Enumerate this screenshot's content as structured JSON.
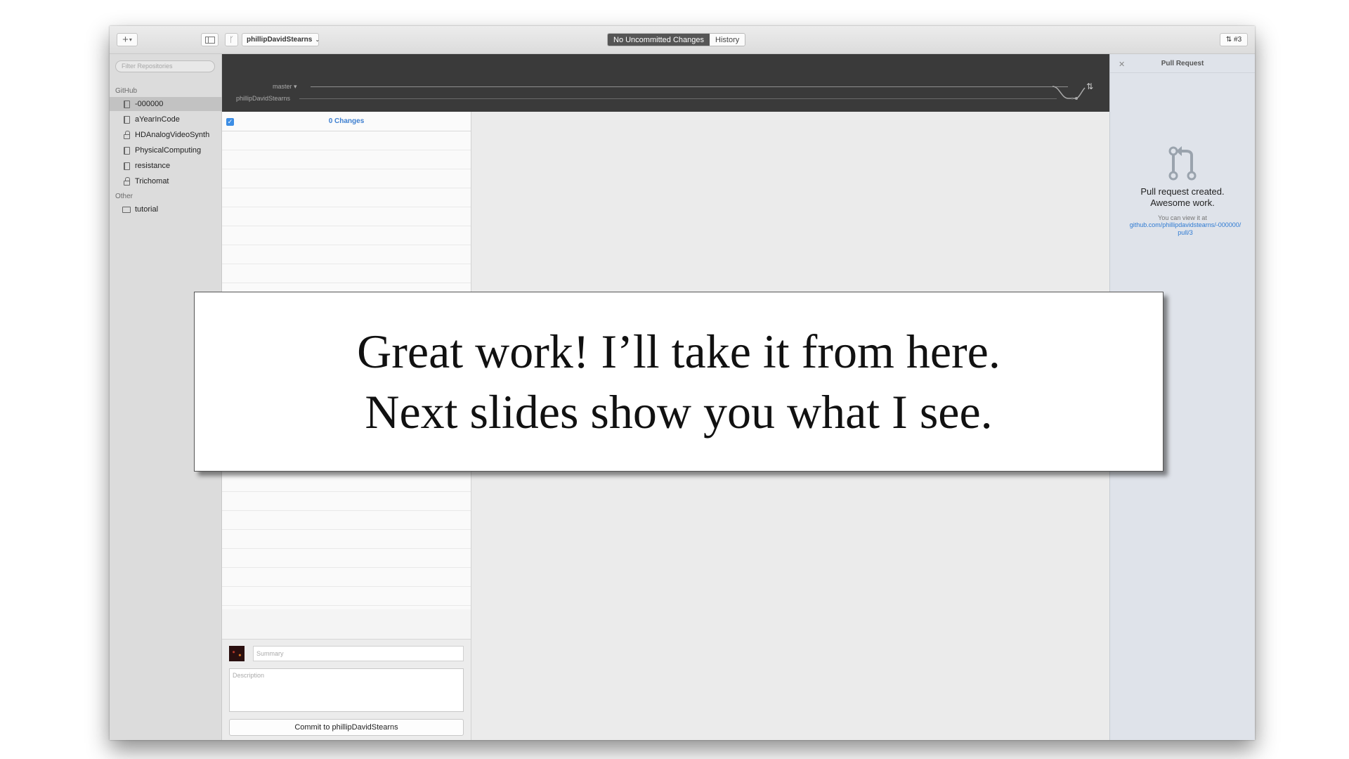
{
  "titlebar": {
    "add_icon": "plus-icon",
    "repo_selector": "phillipDavidStearns",
    "tabs": [
      {
        "label": "No Uncommitted Changes",
        "active": true
      },
      {
        "label": "History",
        "active": false
      }
    ],
    "pull_request_badge": "#3"
  },
  "sidebar": {
    "filter_placeholder": "Filter Repositories",
    "groups": [
      {
        "title": "GitHub",
        "items": [
          {
            "label": "-000000",
            "icon": "repo-icon",
            "selected": true
          },
          {
            "label": "aYearInCode",
            "icon": "repo-icon"
          },
          {
            "label": "HDAnalogVideoSynth",
            "icon": "lock-icon"
          },
          {
            "label": "PhysicalComputing",
            "icon": "repo-icon"
          },
          {
            "label": "resistance",
            "icon": "repo-icon"
          },
          {
            "label": "Trichomat",
            "icon": "lock-icon"
          }
        ]
      },
      {
        "title": "Other",
        "items": [
          {
            "label": "tutorial",
            "icon": "monitor-icon"
          }
        ]
      }
    ]
  },
  "graph": {
    "branch_label": "master ▾",
    "remote_label": "phillipDavidStearns"
  },
  "changes": {
    "title": "0 Changes",
    "summary_placeholder": "Summary",
    "description_placeholder": "Description",
    "commit_label": "Commit to phillipDavidStearns"
  },
  "pull_request_panel": {
    "title": "Pull Request",
    "message_line1": "Pull request created.",
    "message_line2": "Awesome work.",
    "view_text": "You can view it at",
    "link_line1": "github.com/phillipdavidstearns/-000000/",
    "link_line2": "pull/3"
  },
  "overlay": {
    "line1": "Great work! I’ll take it from here.",
    "line2": "Next slides show you what I see."
  },
  "colors": {
    "accent": "#3d8ee5",
    "graph_bg": "#3a3a3a",
    "sidebar_bg": "#dcdcdc",
    "pr_panel_bg": "#dfe3ea"
  }
}
